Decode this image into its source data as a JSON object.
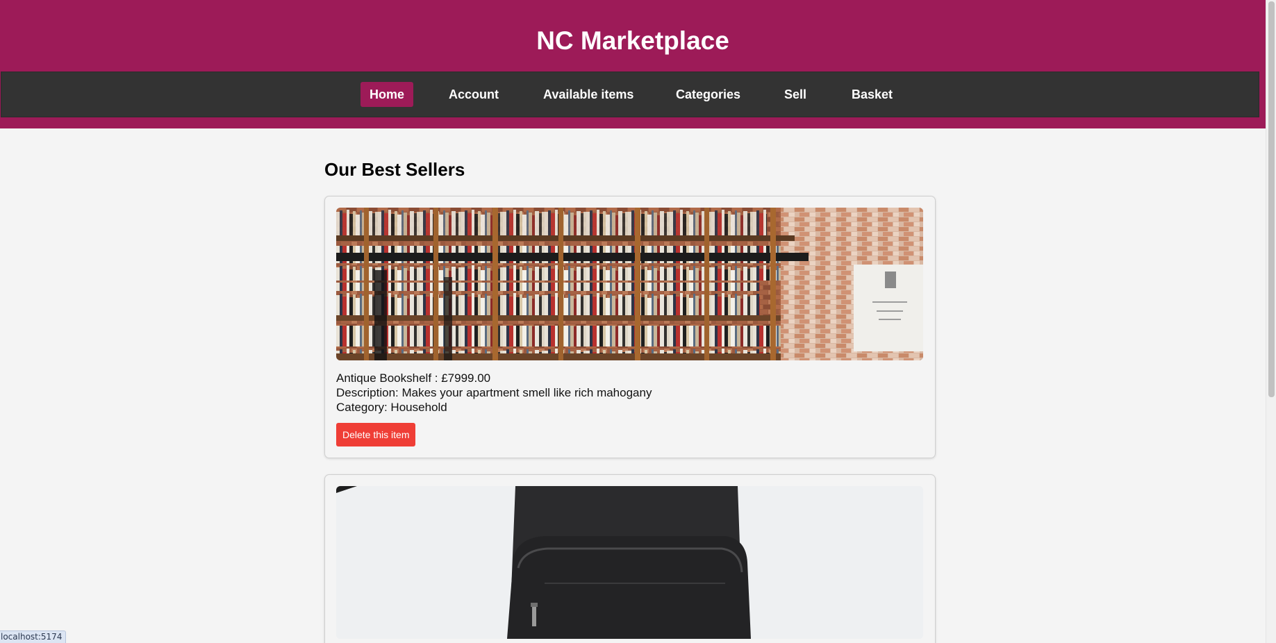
{
  "header": {
    "title": "NC Marketplace",
    "brand_color": "#9d1b58"
  },
  "nav": {
    "items": [
      {
        "label": "Home",
        "active": true
      },
      {
        "label": "Account"
      },
      {
        "label": "Available items"
      },
      {
        "label": "Categories"
      },
      {
        "label": "Sell"
      },
      {
        "label": "Basket"
      }
    ]
  },
  "main": {
    "section_title": "Our Best Sellers",
    "items": [
      {
        "title_line": "Antique Bookshelf : £7999.00",
        "description_line": "Description: Makes your apartment smell like rich mahogany",
        "category_line": "Category: Household",
        "delete_label": "Delete this item",
        "image": "bookshelf-photo"
      },
      {
        "image": "backpack-photo"
      }
    ]
  },
  "status_bar": {
    "url": "localhost:5174"
  },
  "colors": {
    "accent": "#9d1b58",
    "nav_bg": "#333333",
    "delete": "#ef3e36",
    "page_bg": "#f4f4f4"
  }
}
